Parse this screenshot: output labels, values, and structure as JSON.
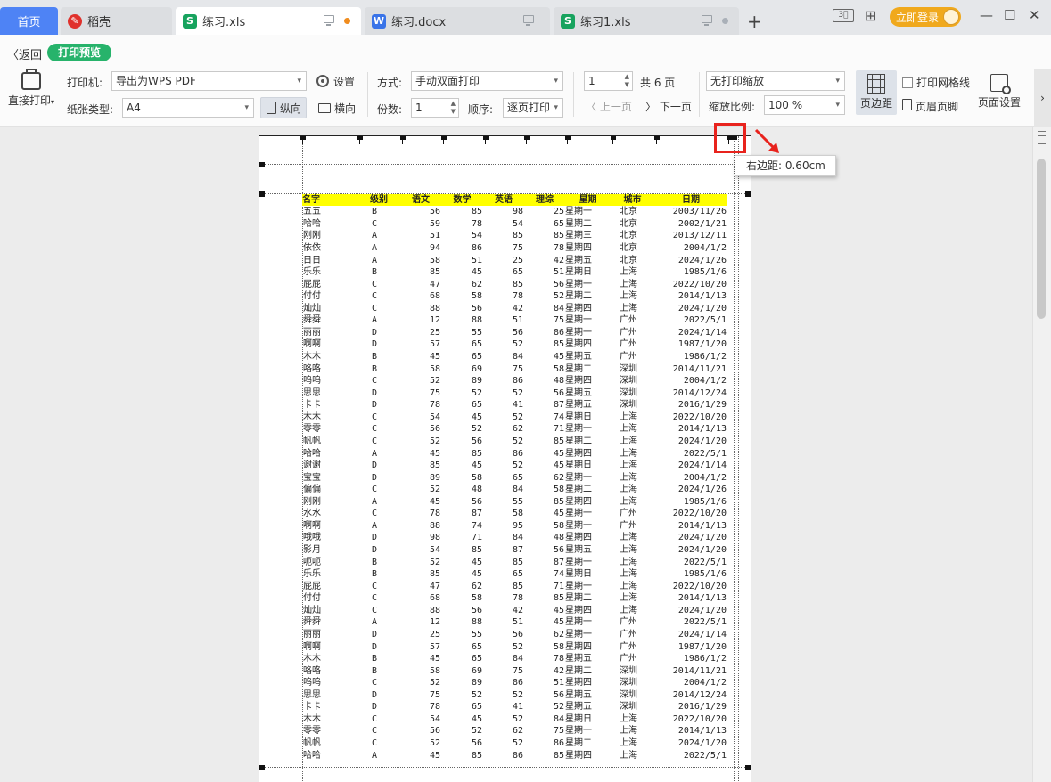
{
  "tabs": {
    "home": "首页",
    "daoke": "稻壳",
    "active_file": "练习.xls",
    "doc_file": "练习.docx",
    "xls1_file": "练习1.xls",
    "new_tab": "+"
  },
  "titlebar": {
    "login": "立即登录",
    "minimize": "—",
    "maximize": "☐",
    "close": "✕"
  },
  "toolbar": {
    "back": "返回",
    "mode_pill": "打印预览",
    "direct_print": "直接打印",
    "printer_label": "打印机:",
    "printer_value": "导出为WPS PDF",
    "settings": "设置",
    "paper_label": "纸张类型:",
    "paper_value": "A4",
    "portrait": "纵向",
    "landscape": "横向",
    "method_label": "方式:",
    "method_value": "手动双面打印",
    "copies_label": "份数:",
    "copies_value": "1",
    "order_label": "顺序:",
    "order_value": "逐页打印",
    "page_value": "1",
    "total_pages": "共 6 页",
    "prev_page": "上一页",
    "next_page": "下一页",
    "scale_mode": "无打印缩放",
    "zoom_label": "缩放比例:",
    "zoom_value": "100 %",
    "margins": "页边距",
    "gridlines": "打印网格线",
    "header_footer": "页眉页脚",
    "page_setup": "页面设置"
  },
  "tooltip": {
    "text": "右边距:  0.60cm"
  },
  "sheet": {
    "headers": [
      "名字",
      "级别",
      "语文",
      "数学",
      "英语",
      "理综",
      "星期",
      "城市",
      "日期"
    ],
    "rows": [
      [
        "五五",
        "B",
        "56",
        "85",
        "98",
        "25",
        "星期一",
        "北京",
        "2003/11/26"
      ],
      [
        "哈哈",
        "C",
        "59",
        "78",
        "54",
        "65",
        "星期二",
        "北京",
        "2002/1/21"
      ],
      [
        "刚刚",
        "A",
        "51",
        "54",
        "85",
        "85",
        "星期三",
        "北京",
        "2013/12/11"
      ],
      [
        "依依",
        "A",
        "94",
        "86",
        "75",
        "78",
        "星期四",
        "北京",
        "2004/1/2"
      ],
      [
        "日日",
        "A",
        "58",
        "51",
        "25",
        "42",
        "星期五",
        "北京",
        "2024/1/26"
      ],
      [
        "乐乐",
        "B",
        "85",
        "45",
        "65",
        "51",
        "星期日",
        "上海",
        "1985/1/6"
      ],
      [
        "屁屁",
        "C",
        "47",
        "62",
        "85",
        "56",
        "星期一",
        "上海",
        "2022/10/20"
      ],
      [
        "付付",
        "C",
        "68",
        "58",
        "78",
        "52",
        "星期二",
        "上海",
        "2014/1/13"
      ],
      [
        "灿灿",
        "C",
        "88",
        "56",
        "42",
        "84",
        "星期四",
        "上海",
        "2024/1/20"
      ],
      [
        "舜舜",
        "A",
        "12",
        "88",
        "51",
        "75",
        "星期一",
        "广州",
        "2022/5/1"
      ],
      [
        "丽丽",
        "D",
        "25",
        "55",
        "56",
        "86",
        "星期一",
        "广州",
        "2024/1/14"
      ],
      [
        "啊啊",
        "D",
        "57",
        "65",
        "52",
        "85",
        "星期四",
        "广州",
        "1987/1/20"
      ],
      [
        "木木",
        "B",
        "45",
        "65",
        "84",
        "45",
        "星期五",
        "广州",
        "1986/1/2"
      ],
      [
        "咯咯",
        "B",
        "58",
        "69",
        "75",
        "58",
        "星期二",
        "深圳",
        "2014/11/21"
      ],
      [
        "呜呜",
        "C",
        "52",
        "89",
        "86",
        "48",
        "星期四",
        "深圳",
        "2004/1/2"
      ],
      [
        "思思",
        "D",
        "75",
        "52",
        "52",
        "56",
        "星期五",
        "深圳",
        "2014/12/24"
      ],
      [
        "卡卡",
        "D",
        "78",
        "65",
        "41",
        "87",
        "星期五",
        "深圳",
        "2016/1/29"
      ],
      [
        "木木",
        "C",
        "54",
        "45",
        "52",
        "74",
        "星期日",
        "上海",
        "2022/10/20"
      ],
      [
        "零零",
        "C",
        "56",
        "52",
        "62",
        "71",
        "星期一",
        "上海",
        "2014/1/13"
      ],
      [
        "帆帆",
        "C",
        "52",
        "56",
        "52",
        "85",
        "星期二",
        "上海",
        "2024/1/20"
      ],
      [
        "哈哈",
        "A",
        "45",
        "85",
        "86",
        "45",
        "星期四",
        "上海",
        "2022/5/1"
      ],
      [
        "谢谢",
        "D",
        "85",
        "45",
        "52",
        "45",
        "星期日",
        "上海",
        "2024/1/14"
      ],
      [
        "宝宝",
        "D",
        "89",
        "58",
        "65",
        "62",
        "星期一",
        "上海",
        "2004/1/2"
      ],
      [
        "偏偏",
        "C",
        "52",
        "48",
        "84",
        "58",
        "星期二",
        "上海",
        "2024/1/26"
      ],
      [
        "刚刚",
        "A",
        "45",
        "56",
        "55",
        "85",
        "星期四",
        "上海",
        "1985/1/6"
      ],
      [
        "水水",
        "C",
        "78",
        "87",
        "58",
        "45",
        "星期一",
        "广州",
        "2022/10/20"
      ],
      [
        "啊啊",
        "A",
        "88",
        "74",
        "95",
        "58",
        "星期一",
        "广州",
        "2014/1/13"
      ],
      [
        "哦哦",
        "D",
        "98",
        "71",
        "84",
        "48",
        "星期四",
        "上海",
        "2024/1/20"
      ],
      [
        "影月",
        "D",
        "54",
        "85",
        "87",
        "56",
        "星期五",
        "上海",
        "2024/1/20"
      ],
      [
        "呃呃",
        "B",
        "52",
        "45",
        "85",
        "87",
        "星期一",
        "上海",
        "2022/5/1"
      ],
      [
        "乐乐",
        "B",
        "85",
        "45",
        "65",
        "74",
        "星期日",
        "上海",
        "1985/1/6"
      ],
      [
        "屁屁",
        "C",
        "47",
        "62",
        "85",
        "71",
        "星期一",
        "上海",
        "2022/10/20"
      ],
      [
        "付付",
        "C",
        "68",
        "58",
        "78",
        "85",
        "星期二",
        "上海",
        "2014/1/13"
      ],
      [
        "灿灿",
        "C",
        "88",
        "56",
        "42",
        "45",
        "星期四",
        "上海",
        "2024/1/20"
      ],
      [
        "舜舜",
        "A",
        "12",
        "88",
        "51",
        "45",
        "星期一",
        "广州",
        "2022/5/1"
      ],
      [
        "丽丽",
        "D",
        "25",
        "55",
        "56",
        "62",
        "星期一",
        "广州",
        "2024/1/14"
      ],
      [
        "啊啊",
        "D",
        "57",
        "65",
        "52",
        "58",
        "星期四",
        "广州",
        "1987/1/20"
      ],
      [
        "木木",
        "B",
        "45",
        "65",
        "84",
        "78",
        "星期五",
        "广州",
        "1986/1/2"
      ],
      [
        "咯咯",
        "B",
        "58",
        "69",
        "75",
        "42",
        "星期二",
        "深圳",
        "2014/11/21"
      ],
      [
        "呜呜",
        "C",
        "52",
        "89",
        "86",
        "51",
        "星期四",
        "深圳",
        "2004/1/2"
      ],
      [
        "思思",
        "D",
        "75",
        "52",
        "52",
        "56",
        "星期五",
        "深圳",
        "2014/12/24"
      ],
      [
        "卡卡",
        "D",
        "78",
        "65",
        "41",
        "52",
        "星期五",
        "深圳",
        "2016/1/29"
      ],
      [
        "木木",
        "C",
        "54",
        "45",
        "52",
        "84",
        "星期日",
        "上海",
        "2022/10/20"
      ],
      [
        "零零",
        "C",
        "56",
        "52",
        "62",
        "75",
        "星期一",
        "上海",
        "2014/1/13"
      ],
      [
        "帆帆",
        "C",
        "52",
        "56",
        "52",
        "86",
        "星期二",
        "上海",
        "2024/1/20"
      ],
      [
        "哈哈",
        "A",
        "45",
        "85",
        "86",
        "85",
        "星期四",
        "上海",
        "2022/5/1"
      ]
    ]
  },
  "colors": {
    "accent_blue": "#4e83f5",
    "pill_green": "#27b36b",
    "header_yellow": "#ffff00",
    "highlight_red": "#e8231d",
    "login_orange": "#f0a91d"
  }
}
